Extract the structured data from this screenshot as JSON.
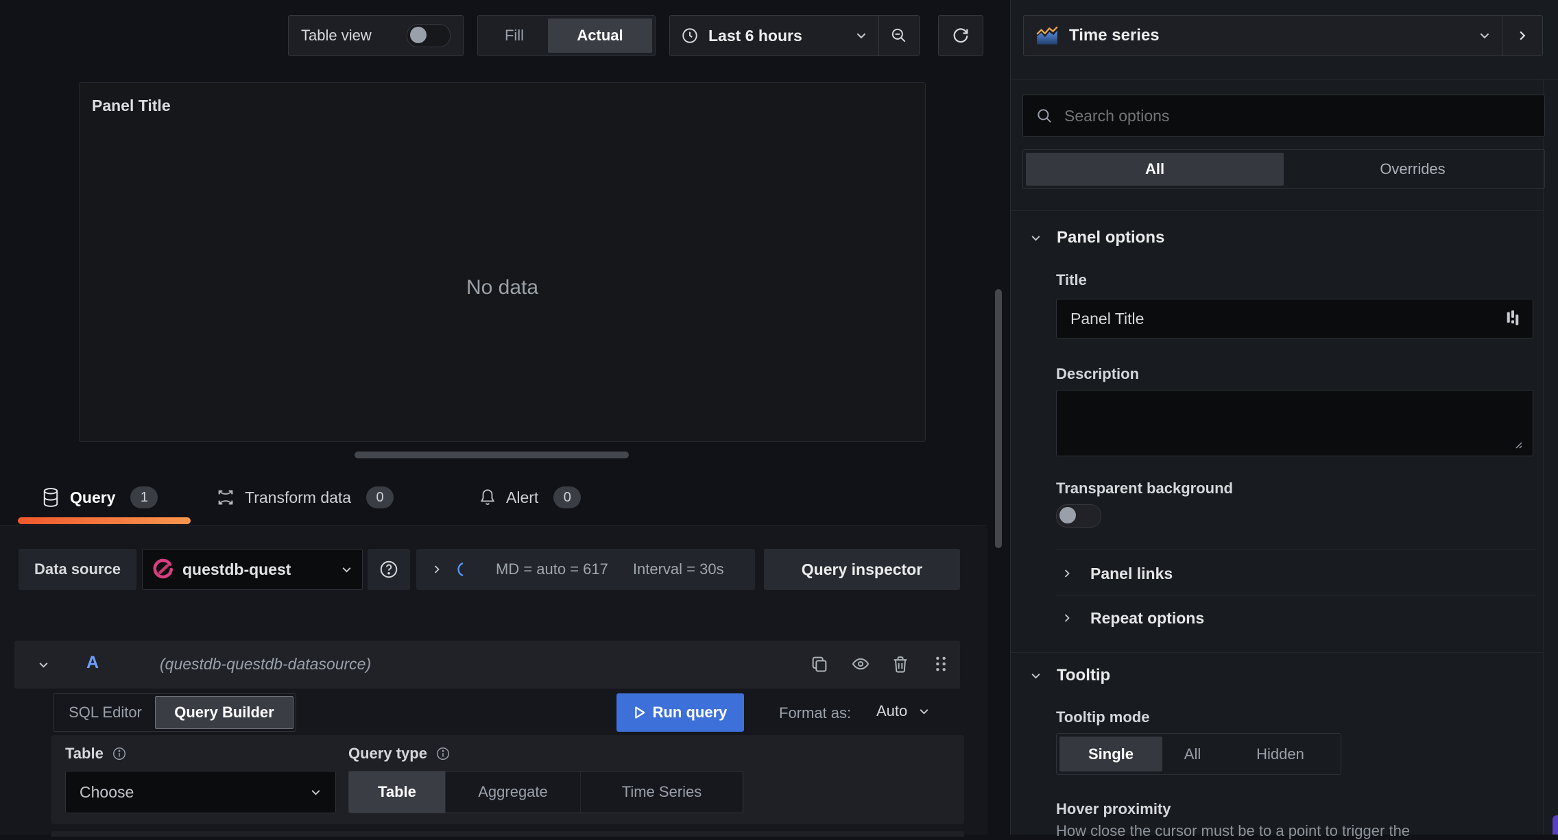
{
  "toolbar": {
    "table_view": "Table view",
    "fill": "Fill",
    "actual": "Actual",
    "time_range": "Last 6 hours"
  },
  "viz_picker": {
    "label": "Time series"
  },
  "panel": {
    "title": "Panel Title",
    "no_data": "No data"
  },
  "tabs": [
    {
      "label": "Query",
      "badge": "1"
    },
    {
      "label": "Transform data",
      "badge": "0"
    },
    {
      "label": "Alert",
      "badge": "0"
    }
  ],
  "query_toolbar": {
    "datasource_label": "Data source",
    "datasource_name": "questdb-quest",
    "md_summary": "MD = auto = 617",
    "interval_summary": "Interval = 30s",
    "query_inspector": "Query inspector"
  },
  "query_row": {
    "ref_id": "A",
    "datasource_hint": "(questdb-questdb-datasource)"
  },
  "editor": {
    "sql_editor": "SQL Editor",
    "query_builder": "Query Builder",
    "run_query": "Run query",
    "format_as_label": "Format as:",
    "format_as_value": "Auto",
    "table_label": "Table",
    "table_placeholder": "Choose",
    "query_type_label": "Query type",
    "query_type": [
      "Table",
      "Aggregate",
      "Time Series"
    ]
  },
  "options": {
    "search_placeholder": "Search options",
    "filter": [
      "All",
      "Overrides"
    ],
    "panel_options": {
      "header": "Panel options",
      "title_label": "Title",
      "title_value": "Panel Title",
      "description_label": "Description",
      "transparent_label": "Transparent background",
      "links": "Panel links",
      "repeat": "Repeat options"
    },
    "tooltip": {
      "header": "Tooltip",
      "mode_label": "Tooltip mode",
      "modes": [
        "Single",
        "All",
        "Hidden"
      ],
      "hover_label": "Hover proximity",
      "hover_help": "How close the cursor must be to a point to trigger the"
    }
  },
  "colors": {
    "accent_blue": "#3d71d9",
    "tab_underline_start": "#f0592e",
    "tab_underline_end": "#f9964e",
    "questdb_pink": "#d93d82",
    "refid_blue": "#6e9fff"
  }
}
